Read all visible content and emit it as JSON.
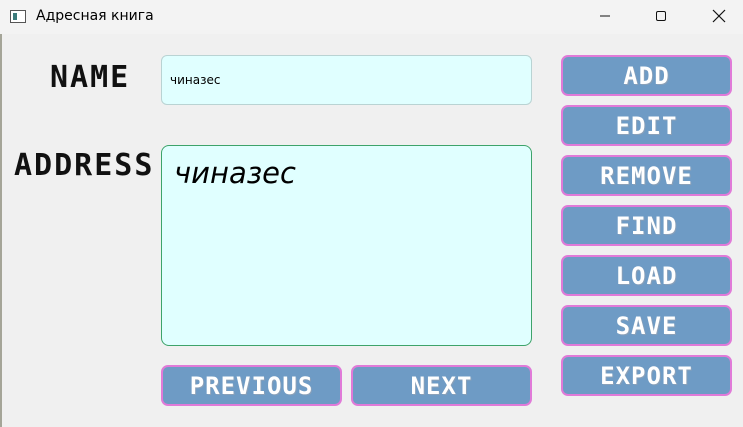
{
  "window": {
    "title": "Адресная книга"
  },
  "form": {
    "name_label": "NAME",
    "address_label": "ADDRESS",
    "name_value": "чиназес",
    "address_value": "чиназес"
  },
  "buttons": {
    "add": "ADD",
    "edit": "EDIT",
    "remove": "REMOVE",
    "find": "FIND",
    "load": "LOAD",
    "save": "SAVE",
    "export": "EXPORT",
    "previous": "PREVIOUS",
    "next": "NEXT"
  },
  "colors": {
    "button_fill": "#6e9bc5",
    "button_border": "#e07ad8",
    "field_fill": "#e0ffff",
    "address_border": "#3da36a"
  },
  "icons": {
    "minimize": "minimize-icon",
    "maximize": "maximize-icon",
    "close": "close-icon"
  }
}
